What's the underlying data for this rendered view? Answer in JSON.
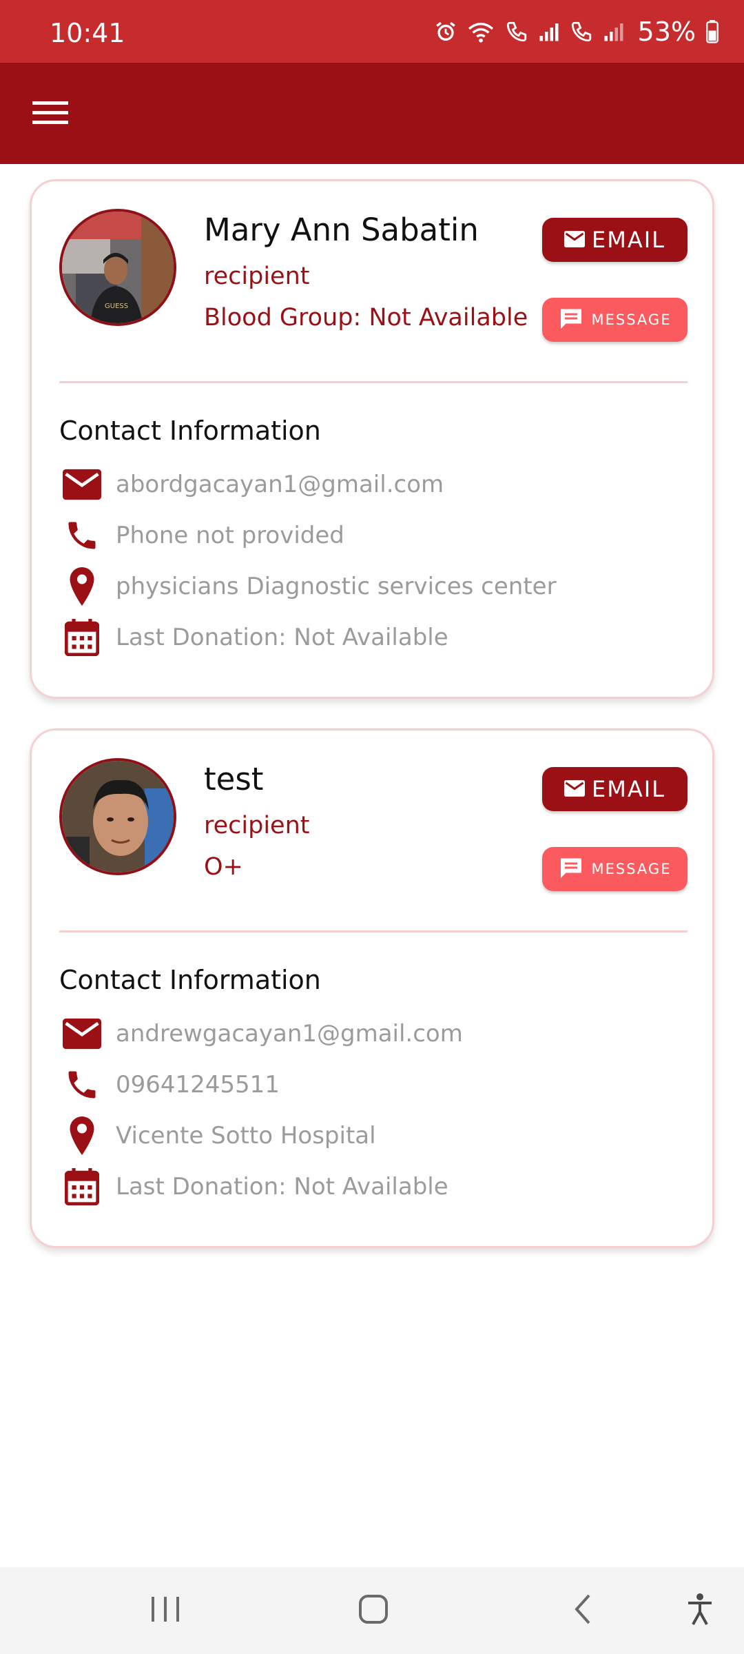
{
  "status_bar": {
    "time": "10:41",
    "battery": "53%",
    "icons": [
      "alarm-icon",
      "wifi-icon",
      "call-sim1-icon",
      "signal-icon",
      "call-sim2-icon",
      "signal-icon",
      "battery-icon"
    ]
  },
  "app_bar": {
    "menu_icon": "hamburger-menu-icon"
  },
  "colors": {
    "status_bar": "#c62b2e",
    "app_bar": "#9b1014",
    "accent": "#9b1014",
    "message_button": "#fb5a5e",
    "card_border": "#f6cfd1",
    "muted_text": "#9b9b9b"
  },
  "contacts": [
    {
      "name": "Mary Ann Sabatin",
      "role": "recipient",
      "blood_group": "Blood Group: Not Available",
      "email_button": "EMAIL",
      "message_button": "MESSAGE",
      "section_title": "Contact Information",
      "email": "abordgacayan1@gmail.com",
      "phone": "Phone not provided",
      "location": "physicians Diagnostic services center",
      "last_donation": "Last Donation: Not Available"
    },
    {
      "name": "test",
      "role": "recipient",
      "blood_group": "O+",
      "email_button": "EMAIL",
      "message_button": "MESSAGE",
      "section_title": "Contact Information",
      "email": "andrewgacayan1@gmail.com",
      "phone": "09641245511",
      "location": "Vicente Sotto Hospital",
      "last_donation": "Last Donation: Not Available"
    }
  ],
  "nav_bar": {
    "icons": [
      "recents-icon",
      "home-icon",
      "back-icon",
      "accessibility-icon"
    ]
  }
}
